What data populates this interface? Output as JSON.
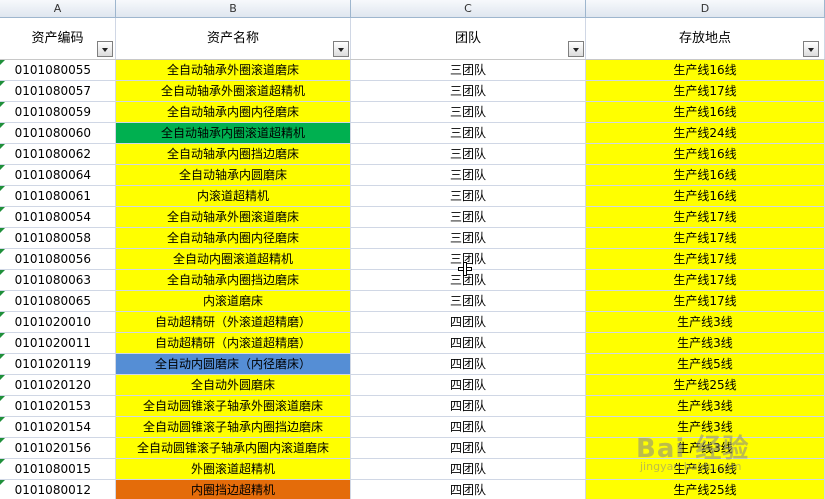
{
  "columns": [
    "A",
    "B",
    "C",
    "D"
  ],
  "headers": [
    "资产编码",
    "资产名称",
    "团队",
    "存放地点"
  ],
  "colors": {
    "yellow": "#ffff00",
    "white": "#ffffff",
    "green": "#00b050",
    "blue": "#558ed5",
    "orange": "#e46c0a"
  },
  "rows": [
    {
      "code": "0101080055",
      "name": "全自动轴承外圈滚道磨床",
      "name_bg": "yellow",
      "team": "三团队",
      "loc": "生产线16线"
    },
    {
      "code": "0101080057",
      "name": "全自动轴承外圈滚道超精机",
      "name_bg": "yellow",
      "team": "三团队",
      "loc": "生产线17线"
    },
    {
      "code": "0101080059",
      "name": "全自动轴承内圈内径磨床",
      "name_bg": "yellow",
      "team": "三团队",
      "loc": "生产线16线"
    },
    {
      "code": "0101080060",
      "name": "全自动轴承内圈滚道超精机",
      "name_bg": "green",
      "team": "三团队",
      "loc": "生产线24线"
    },
    {
      "code": "0101080062",
      "name": "全自动轴承内圈挡边磨床",
      "name_bg": "yellow",
      "team": "三团队",
      "loc": "生产线16线"
    },
    {
      "code": "0101080064",
      "name": "全自动轴承内圆磨床",
      "name_bg": "yellow",
      "team": "三团队",
      "loc": "生产线16线"
    },
    {
      "code": "0101080061",
      "name": "内滚道超精机",
      "name_bg": "yellow",
      "team": "三团队",
      "loc": "生产线16线"
    },
    {
      "code": "0101080054",
      "name": "全自动轴承外圈滚道磨床",
      "name_bg": "yellow",
      "team": "三团队",
      "loc": "生产线17线"
    },
    {
      "code": "0101080058",
      "name": "全自动轴承内圈内径磨床",
      "name_bg": "yellow",
      "team": "三团队",
      "loc": "生产线17线"
    },
    {
      "code": "0101080056",
      "name": "全自动内圈滚道超精机",
      "name_bg": "yellow",
      "team": "三团队",
      "loc": "生产线17线"
    },
    {
      "code": "0101080063",
      "name": "全自动轴承内圈挡边磨床",
      "name_bg": "yellow",
      "team": "三团队",
      "loc": "生产线17线"
    },
    {
      "code": "0101080065",
      "name": "内滚道磨床",
      "name_bg": "yellow",
      "team": "三团队",
      "loc": "生产线17线"
    },
    {
      "code": "0101020010",
      "name": "自动超精研（外滚道超精磨）",
      "name_bg": "yellow",
      "team": "四团队",
      "loc": "生产线3线"
    },
    {
      "code": "0101020011",
      "name": "自动超精研（内滚道超精磨）",
      "name_bg": "yellow",
      "team": "四团队",
      "loc": "生产线3线"
    },
    {
      "code": "0101020119",
      "name": "全自动内圆磨床（内径磨床）",
      "name_bg": "blue",
      "team": "四团队",
      "loc": "生产线5线"
    },
    {
      "code": "0101020120",
      "name": "全自动外圆磨床",
      "name_bg": "yellow",
      "team": "四团队",
      "loc": "生产线25线"
    },
    {
      "code": "0101020153",
      "name": "全自动圆锥滚子轴承外圈滚道磨床",
      "name_bg": "yellow",
      "team": "四团队",
      "loc": "生产线3线"
    },
    {
      "code": "0101020154",
      "name": "全自动圆锥滚子轴承内圈挡边磨床",
      "name_bg": "yellow",
      "team": "四团队",
      "loc": "生产线3线"
    },
    {
      "code": "0101020156",
      "name": "全自动圆锥滚子轴承内圈内滚道磨床",
      "name_bg": "yellow",
      "team": "四团队",
      "loc": "生产线3线"
    },
    {
      "code": "0101080015",
      "name": "外圈滚道超精机",
      "name_bg": "yellow",
      "team": "四团队",
      "loc": "生产线16线"
    },
    {
      "code": "0101080012",
      "name": "内圈挡边超精机",
      "name_bg": "orange",
      "team": "四团队",
      "loc": "生产线25线"
    }
  ],
  "watermark": {
    "logo": "Bai 经验",
    "url": "jingyan.baidu.com"
  }
}
